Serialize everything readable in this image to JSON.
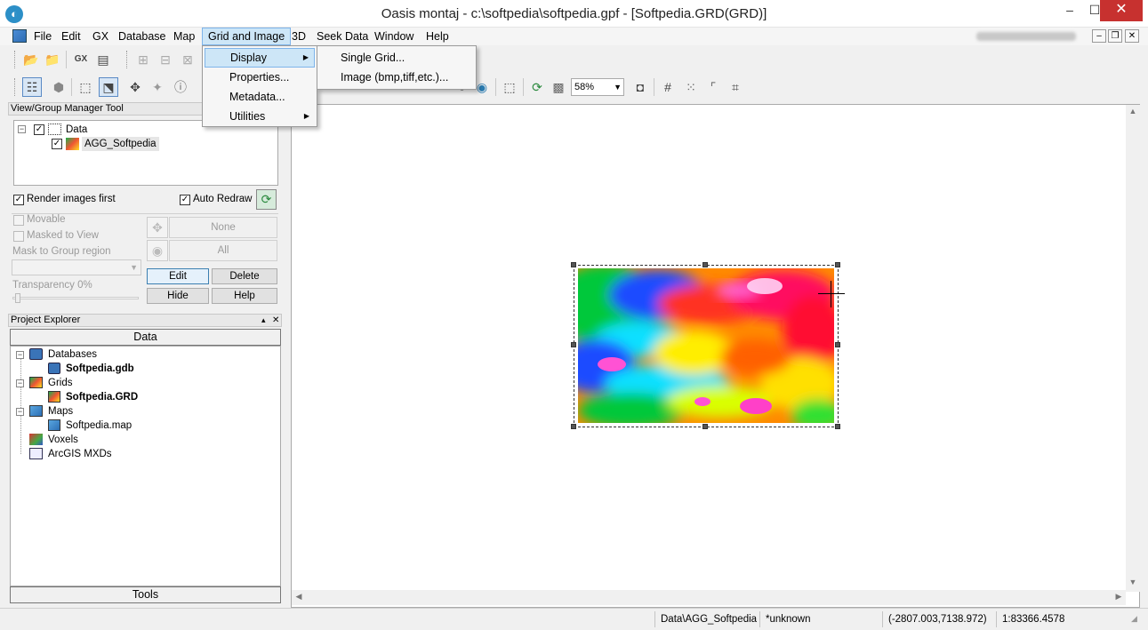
{
  "window": {
    "title": "Oasis montaj - c:\\softpedia\\softpedia.gpf - [Softpedia.GRD(GRD)]",
    "min_symbol": "–",
    "max_symbol": "☐",
    "close_symbol": "✕"
  },
  "menubar": {
    "items": [
      "File",
      "Edit",
      "GX",
      "Database",
      "Map",
      "Grid and Image",
      "3D",
      "Seek Data",
      "Window",
      "Help"
    ],
    "active": "Grid and Image"
  },
  "mdi_controls": {
    "min": "–",
    "restore": "❐",
    "close": "✕"
  },
  "grid_menu": {
    "items": [
      {
        "label": "Display",
        "has_submenu": true,
        "highlighted": true
      },
      {
        "label": "Properties...",
        "has_submenu": false
      },
      {
        "label": "Metadata...",
        "has_submenu": false
      },
      {
        "label": "Utilities",
        "has_submenu": true
      }
    ]
  },
  "display_submenu": {
    "items": [
      "Single Grid...",
      "Image (bmp,tiff,etc.)..."
    ]
  },
  "toolbar": {
    "gx_label": "GX",
    "zoom_value": "58%"
  },
  "view_group_manager": {
    "title": "View/Group Manager Tool",
    "tree": [
      {
        "label": "Data",
        "checked": true
      },
      {
        "label": "AGG_Softpedia",
        "checked": true
      }
    ],
    "render_images_first": "Render images first",
    "auto_redraw": "Auto Redraw",
    "movable": "Movable",
    "masked_to_view": "Masked to View",
    "mask_to_group_region": "Mask to Group region",
    "transparency": "Transparency 0%",
    "none_button": "None",
    "all_button": "All",
    "edit_button": "Edit",
    "delete_button": "Delete",
    "hide_button": "Hide",
    "help_button": "Help"
  },
  "project_explorer": {
    "title": "Project Explorer",
    "pin_symbol": "▴",
    "close_symbol": "✕",
    "tab_data": "Data",
    "tab_tools": "Tools",
    "tree": {
      "databases": "Databases",
      "database_file": "Softpedia.gdb",
      "grids": "Grids",
      "grid_file": "Softpedia.GRD",
      "maps": "Maps",
      "map_file": "Softpedia.map",
      "voxels": "Voxels",
      "arcgis": "ArcGIS MXDs"
    }
  },
  "status": {
    "group": "Data\\AGG_Softpedia",
    "projection": "*unknown",
    "coords": "(-2807.003,7138.972)",
    "scale": "1:83366.4578"
  },
  "colors": {
    "menu_highlight": "#cde6f7",
    "menu_highlight_border": "#7eb4ea",
    "close_button": "#c7312f"
  }
}
